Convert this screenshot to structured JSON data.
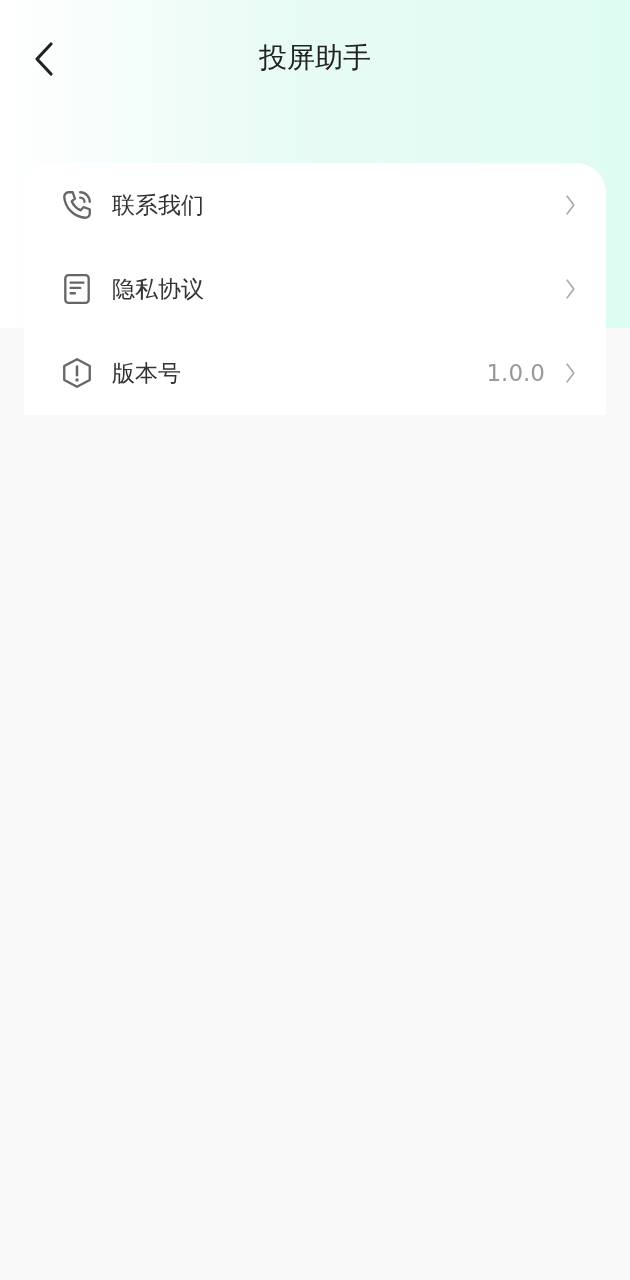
{
  "header": {
    "title": "投屏助手"
  },
  "menu": [
    {
      "kind": "phone",
      "label": "联系我们"
    },
    {
      "kind": "document",
      "label": "隐私协议"
    },
    {
      "kind": "info",
      "label": "版本号",
      "value": "1.0.0"
    }
  ]
}
